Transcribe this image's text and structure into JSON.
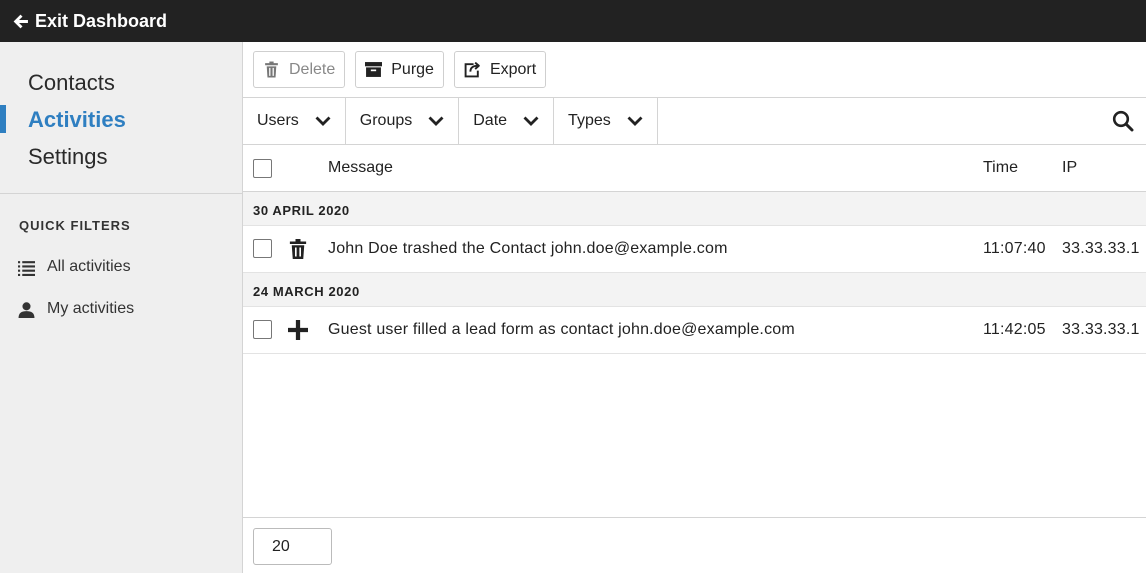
{
  "topbar": {
    "exit_label": "Exit Dashboard",
    "exit_icon": "arrow-left-icon"
  },
  "sidebar": {
    "nav": [
      {
        "label": "Contacts",
        "active": false
      },
      {
        "label": "Activities",
        "active": true
      },
      {
        "label": "Settings",
        "active": false
      }
    ],
    "quick_filters_title": "QUICK FILTERS",
    "quick_filters": [
      {
        "label": "All activities",
        "icon": "list-icon"
      },
      {
        "label": "My activities",
        "icon": "user-icon"
      }
    ]
  },
  "toolbar": {
    "delete_label": "Delete",
    "purge_label": "Purge",
    "export_label": "Export"
  },
  "filters": [
    {
      "label": "Users"
    },
    {
      "label": "Groups"
    },
    {
      "label": "Date"
    },
    {
      "label": "Types"
    }
  ],
  "table": {
    "headers": {
      "message": "Message",
      "time": "Time",
      "ip": "IP"
    },
    "groups": [
      {
        "date": "30 APRIL 2020",
        "rows": [
          {
            "icon": "trash-icon",
            "message": "John Doe trashed the Contact john.doe@example.com",
            "time": "11:07:40",
            "ip": "33.33.33.1"
          }
        ]
      },
      {
        "date": "24 MARCH 2020",
        "rows": [
          {
            "icon": "plus-icon",
            "message": "Guest user filled a lead form as contact john.doe@example.com",
            "time": "11:42:05",
            "ip": "33.33.33.1"
          }
        ]
      }
    ]
  },
  "pagination": {
    "per_page": "20"
  },
  "colors": {
    "accent": "#2f7fc1",
    "topbar": "#222222",
    "sidebar_bg": "#efefef"
  }
}
